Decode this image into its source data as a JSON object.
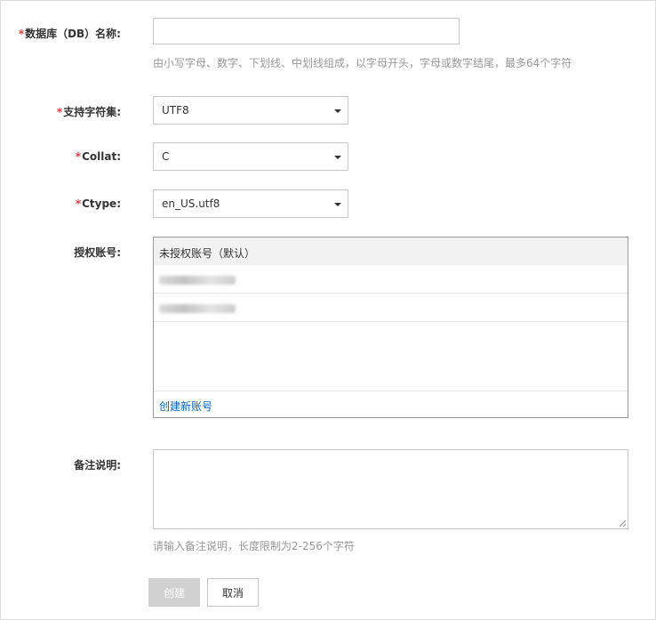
{
  "form": {
    "db_name": {
      "required_mark": "*",
      "label": "数据库（DB）名称:",
      "value": "",
      "hint": "由小写字母、数字、下划线、中划线组成，以字母开头，字母或数字结尾，最多64个字符"
    },
    "charset": {
      "required_mark": "*",
      "label": "支持字符集:",
      "selected": "UTF8"
    },
    "collat": {
      "required_mark": "*",
      "label": "Collat:",
      "selected": "C"
    },
    "ctype": {
      "required_mark": "*",
      "label": "Ctype:",
      "selected": "en_US.utf8"
    },
    "accounts": {
      "label": "授权账号:",
      "default_option": "未授权账号（默认）",
      "items": [
        "[redacted]",
        "[redacted]"
      ],
      "create_link": "创建新账号"
    },
    "remark": {
      "label": "备注说明:",
      "value": "",
      "hint": "请输入备注说明，长度限制为2-256个字符"
    }
  },
  "buttons": {
    "create": "创建",
    "cancel": "取消"
  },
  "colors": {
    "required": "#e4393c",
    "link": "#0066cc",
    "disabled_button": "#d1d1d1",
    "hint_text": "#999999"
  }
}
